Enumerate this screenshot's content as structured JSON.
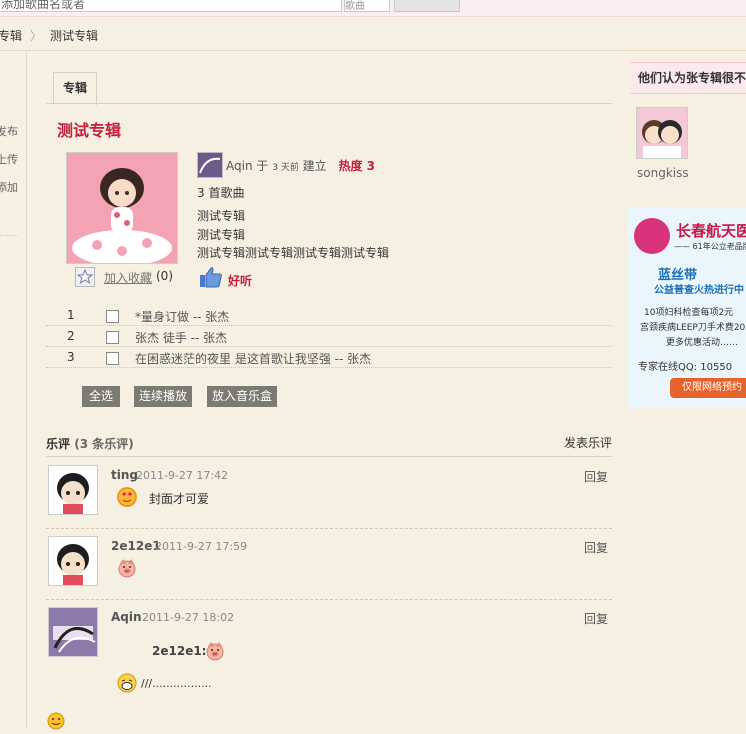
{
  "topbar": {
    "search_value": "添加歌曲名或者",
    "search_option": "歌曲",
    "search_button": "搜索"
  },
  "breadcrumb": {
    "parent": "专辑",
    "current": "测试专辑"
  },
  "leftnav": {
    "items": [
      "发布",
      "上传",
      "添加"
    ]
  },
  "tab": {
    "label": "专辑"
  },
  "album": {
    "title": "测试专辑",
    "owner": "Aqin",
    "yu": "于",
    "time_ago": "3 天前",
    "created": "建立",
    "heat_label": "热度 3",
    "song_count": "3 首歌曲",
    "desc_lines": [
      "测试专辑",
      "测试专辑",
      "测试专辑测试专辑测试专辑测试专辑"
    ],
    "favorite_label": "加入收藏",
    "favorite_count": "(0)",
    "like_label": "好听"
  },
  "tracks": [
    {
      "num": "1",
      "title": "*量身订做 -- 张杰"
    },
    {
      "num": "2",
      "title": "张杰 徒手 -- 张杰"
    },
    {
      "num": "3",
      "title": "在困惑迷茫的夜里 是这首歌让我坚强 -- 张杰"
    }
  ],
  "actions": {
    "select_all": "全选",
    "play_all": "连续播放",
    "add_to_box": "放入音乐盒"
  },
  "comments_section": {
    "title": "乐评",
    "count": "(3 条乐评)",
    "post_link": "发表乐评"
  },
  "comments": [
    {
      "user": "ting",
      "time": "2011-9-27 17:42",
      "text": "封面才可爱",
      "reply": "回复"
    },
    {
      "user": "2e12e1",
      "time": "2011-9-27 17:59",
      "text": "",
      "reply": "回复"
    },
    {
      "user": "Aqin",
      "time": "2011-9-27 18:02",
      "quote_user": "2e12e1:",
      "text": "///.................",
      "reply": "回复"
    }
  ],
  "sidebar": {
    "title": "他们认为张专辑很不错",
    "user": "songkiss",
    "ad": {
      "title": "长春航天医院",
      "sub": "—— 61年公立老品牌",
      "headline": "蓝丝带",
      "headline2": "公益普查火热进行中",
      "line1": "10项妇科检查每项2元",
      "line2": "宫颈疾病LEEP刀手术费20",
      "line3": "更多优惠活动……",
      "qq": "专家在线QQ: 10550",
      "button": "仅限网络预约"
    }
  },
  "colors": {
    "accent": "#c4203c",
    "button_bg": "#7b7b73",
    "page_bg": "#f6f0e2"
  }
}
